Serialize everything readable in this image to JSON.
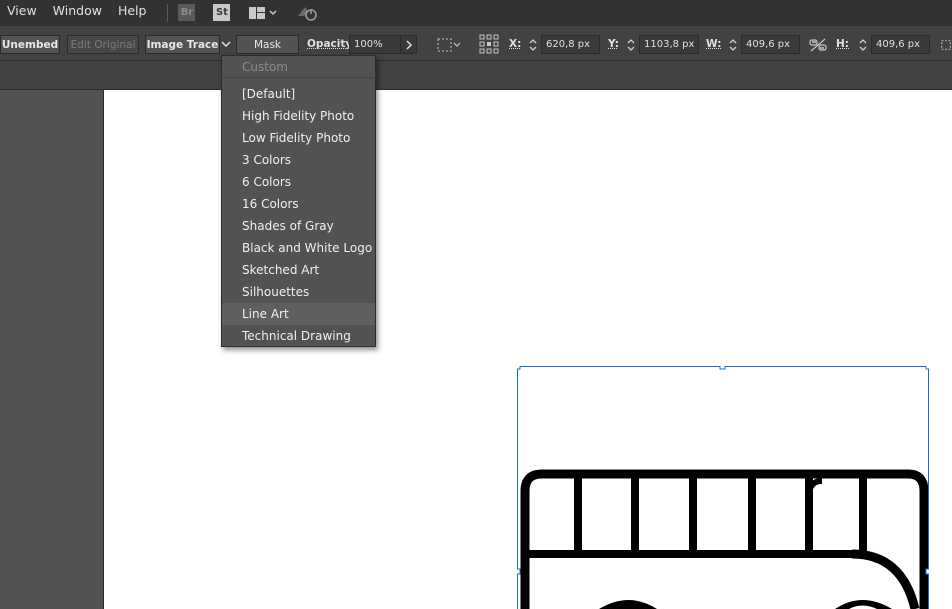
{
  "menubar": {
    "items": [
      "View",
      "Window",
      "Help"
    ],
    "bridge_badge": "Br",
    "stock_badge": "St"
  },
  "controlbar": {
    "unembed_label": "Unembed",
    "edit_original_label": "Edit Original",
    "image_trace_label": "Image Trace",
    "mask_label": "Mask",
    "opacity_label": "Opacity:",
    "opacity_value": "100%",
    "x_label": "X:",
    "x_value": "620,8 px",
    "y_label": "Y:",
    "y_value": "1103,8 px",
    "w_label": "W:",
    "w_value": "409,6 px",
    "h_label": "H:",
    "h_value": "409,6 px"
  },
  "trace_dropdown": {
    "custom_label": "Custom",
    "hovered_index": 11,
    "items": [
      "[Default]",
      "High Fidelity Photo",
      "Low Fidelity Photo",
      "3 Colors",
      "6 Colors",
      "16 Colors",
      "Shades of Gray",
      "Black and White Logo",
      "Sketched Art",
      "Silhouettes",
      "Line Art",
      "Technical Drawing"
    ]
  },
  "colors": {
    "selection": "#1a6fc4",
    "menubar_bg": "#323232",
    "controlbar_bg": "#424242",
    "dropdown_bg": "#525252"
  }
}
